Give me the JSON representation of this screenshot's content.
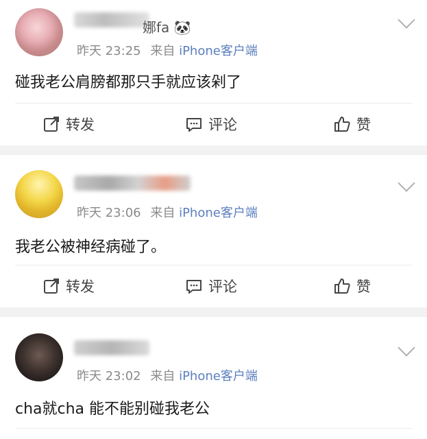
{
  "posts": [
    {
      "name_suffix": "娜fa 🐼",
      "time": "昨天 23:25",
      "source_prefix": "来自",
      "source_app": "iPhone客户端",
      "content": "碰我老公肩膀都那只手就应该剁了",
      "actions": {
        "forward": "转发",
        "comment": "评论",
        "like": "赞"
      }
    },
    {
      "time": "昨天 23:06",
      "source_prefix": "来自",
      "source_app": "iPhone客户端",
      "content": "我老公被神经病碰了。",
      "actions": {
        "forward": "转发",
        "comment": "评论",
        "like": "赞"
      }
    },
    {
      "time": "昨天 23:02",
      "source_prefix": "来自",
      "source_app": "iPhone客户端",
      "content": "cha就cha 能不能别碰我老公"
    }
  ],
  "icons": [
    "share-icon",
    "comment-icon",
    "like-icon",
    "chevron-down-icon"
  ],
  "colors": {
    "source_link": "#5b7fbf",
    "separator": "#f2f2f2",
    "meta_text": "#8a8a8a"
  }
}
